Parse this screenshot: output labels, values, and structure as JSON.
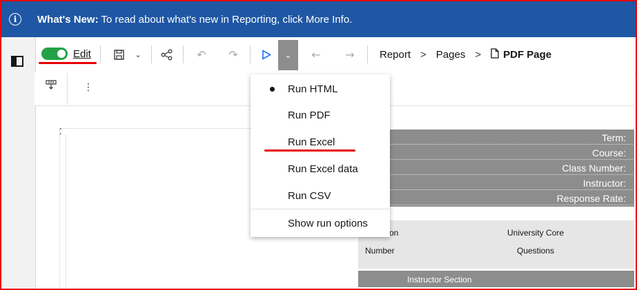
{
  "banner": {
    "heading": "What's New:",
    "message": " To read about what's new in Reporting, click More Info.",
    "icon": "info-icon"
  },
  "toolbar": {
    "edit_label": "Edit",
    "edit_toggle_on": true,
    "icons": [
      "panel-icon",
      "save-icon",
      "chevron-down-icon",
      "share-icon",
      "undo-icon",
      "redo-icon",
      "run-icon",
      "chevron-down-icon",
      "back-arrow-icon",
      "forward-arrow-icon"
    ]
  },
  "breadcrumb": {
    "items": [
      "Report",
      "Pages"
    ],
    "separator": ">",
    "current": "PDF Page"
  },
  "run_menu": {
    "items": [
      {
        "label": "Run HTML",
        "selected": true
      },
      {
        "label": "Run PDF",
        "selected": false
      },
      {
        "label": "Run Excel",
        "selected": false
      },
      {
        "label": "Run Excel data",
        "selected": false
      },
      {
        "label": "Run CSV",
        "selected": false
      }
    ],
    "options_label": "Show run options"
  },
  "report_header": {
    "fields": [
      "Term:",
      "Course:",
      "Class Number:",
      "Instructor:",
      "Response Rate:"
    ]
  },
  "report_table": {
    "col1_top": "on",
    "col1_bottom": "Number",
    "col2_top": "University Core",
    "col2_bottom": "Questions",
    "section": "Instructor Section"
  }
}
